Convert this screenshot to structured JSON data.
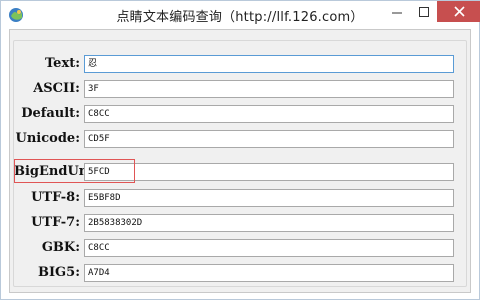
{
  "window": {
    "title": "点睛文本编码查询（http://llf.126.com）"
  },
  "colors": {
    "close_button": "#c74f4f",
    "highlight_border": "#e05555",
    "focus_border": "#5a9bd5"
  },
  "rows": [
    {
      "label": "Text:",
      "value": "忍"
    },
    {
      "label": "ASCII:",
      "value": "3F"
    },
    {
      "label": "Default:",
      "value": "C8CC"
    },
    {
      "label": "Unicode:",
      "value": "CD5F"
    },
    {
      "label": "BigEndUni:",
      "value": "5FCD"
    },
    {
      "label": "UTF-8:",
      "value": "E5BF8D"
    },
    {
      "label": "UTF-7:",
      "value": "2B5838302D"
    },
    {
      "label": "GBK:",
      "value": "C8CC"
    },
    {
      "label": "BIG5:",
      "value": "A7D4"
    }
  ]
}
